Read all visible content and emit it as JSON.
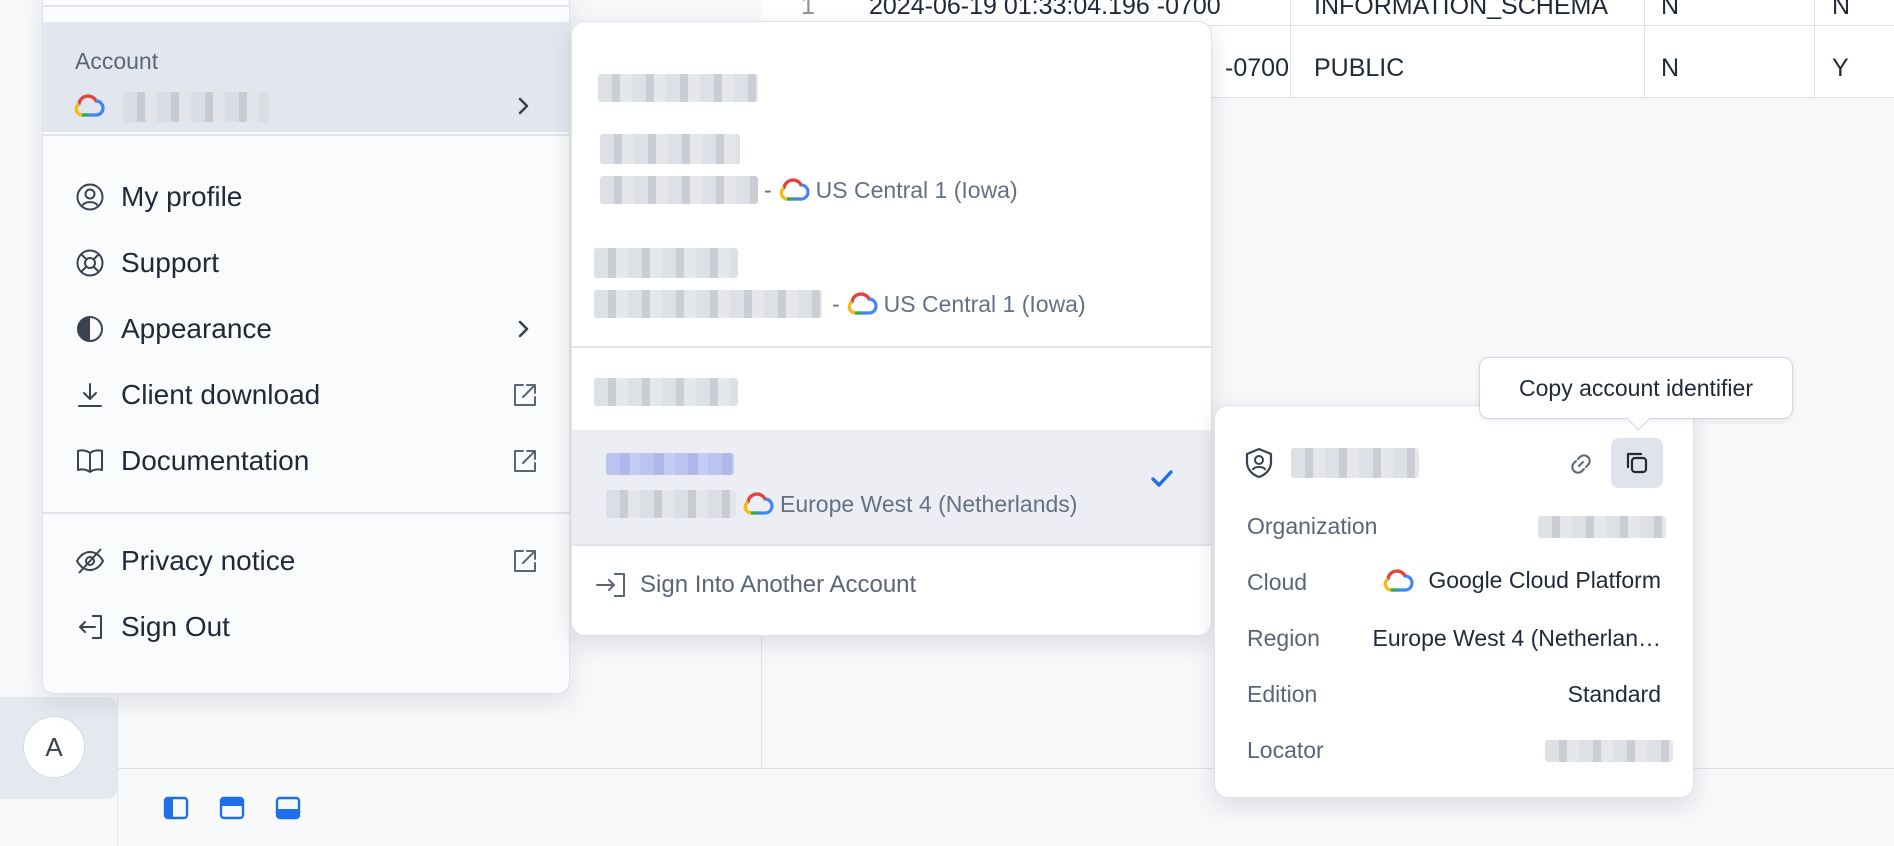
{
  "results_grid": {
    "rows": [
      {
        "num": "1",
        "created": "2024-06-19 01:33:04.196 -0700",
        "name": "INFORMATION_SCHEMA",
        "col_a": "N",
        "col_b": "N"
      },
      {
        "num": "",
        "created": "-0700",
        "name": "PUBLIC",
        "col_a": "N",
        "col_b": "Y"
      }
    ]
  },
  "user_avatar": {
    "initial": "A"
  },
  "menu": {
    "account_label": "Account",
    "items": {
      "profile": "My profile",
      "support": "Support",
      "appearance": "Appearance",
      "client_download": "Client download",
      "documentation": "Documentation",
      "privacy": "Privacy notice",
      "sign_out": "Sign Out"
    }
  },
  "account_switcher": {
    "accounts": [
      {
        "region": "US Central 1 (Iowa)",
        "separator": "-"
      },
      {
        "region": "US Central 1 (Iowa)",
        "separator": "-"
      },
      {
        "region": "Europe West 4 (Netherlands)",
        "selected": true
      }
    ],
    "sign_in_label": "Sign Into Another Account"
  },
  "account_details": {
    "tooltip": "Copy account identifier",
    "fields": {
      "organization_label": "Organization",
      "cloud_label": "Cloud",
      "cloud_value": "Google Cloud Platform",
      "region_label": "Region",
      "region_value": "Europe West 4 (Netherlan…",
      "edition_label": "Edition",
      "edition_value": "Standard",
      "locator_label": "Locator"
    }
  },
  "colors": {
    "accent": "#1f6feb",
    "menu_bg": "#fafbfc",
    "selected_bg": "#e2e7ef",
    "muted_text": "#647084"
  },
  "icons": [
    "gcp-cloud-icon",
    "chevron-right-icon",
    "user-circle-icon",
    "lifebuoy-icon",
    "contrast-icon",
    "download-icon",
    "external-link-icon",
    "book-icon",
    "eye-off-icon",
    "sign-out-icon",
    "sign-in-icon",
    "checkmark-icon",
    "shield-user-icon",
    "link-icon",
    "copy-icon",
    "panel-left-icon",
    "panel-top-icon",
    "panel-bottom-icon"
  ]
}
